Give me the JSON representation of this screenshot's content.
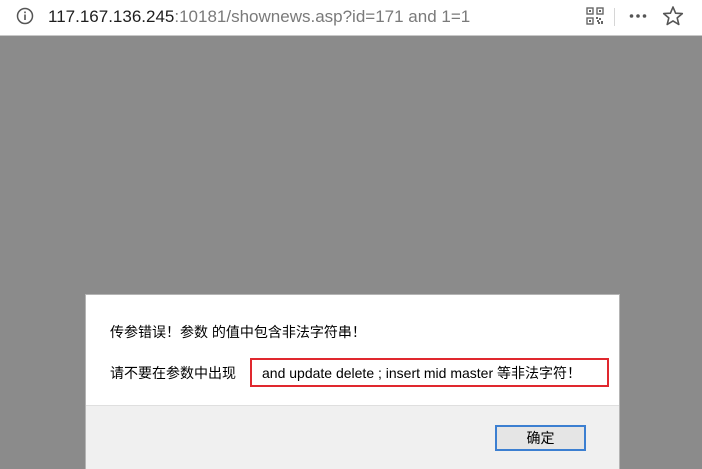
{
  "browser": {
    "url_host": "117.167.136.245",
    "url_rest": ":10181/shownews.asp?id=171 and 1=1",
    "icons": [
      "info-icon",
      "qr-code-icon",
      "more-menu-icon",
      "star-icon"
    ]
  },
  "dialog": {
    "line1": "传参错误！参数 的值中包含非法字符串！",
    "line2_prefix": "请不要在参数中出现",
    "line2_highlight": "and update delete ; insert mid master 等非法字符！",
    "ok_label": "确定",
    "highlight_color": "#e0282e"
  }
}
